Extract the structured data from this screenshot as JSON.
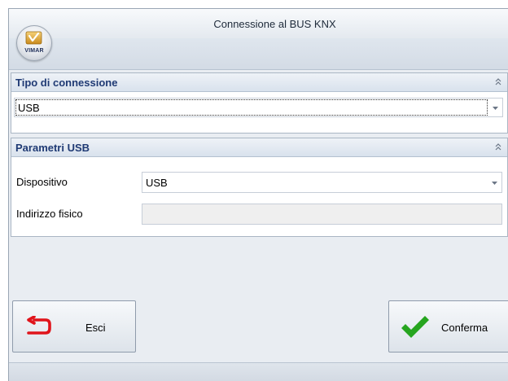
{
  "window": {
    "title": "Connessione al BUS KNX"
  },
  "app_button": {
    "logo_text": "VIMAR",
    "icon": "vimar-logo-icon"
  },
  "connection_group": {
    "title": "Tipo di connessione",
    "type_value": "USB",
    "collapse_icon": "chevron-double-up-icon"
  },
  "usb_group": {
    "title": "Parametri USB",
    "device_label": "Dispositivo",
    "device_value": "USB",
    "address_label": "Indirizzo fisico",
    "address_value": "",
    "collapse_icon": "chevron-double-up-icon"
  },
  "buttons": {
    "exit_label": "Esci",
    "exit_icon": "back-arrow-icon",
    "confirm_label": "Conferma",
    "confirm_icon": "checkmark-icon"
  },
  "colors": {
    "group_title": "#1f3a74",
    "exit_arrow": "#e0141b",
    "confirm_check": "#26a51f"
  }
}
